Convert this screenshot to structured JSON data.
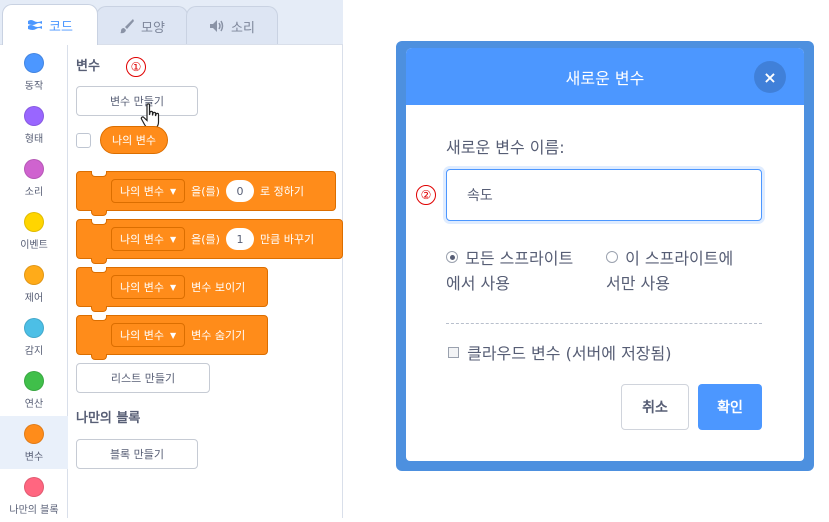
{
  "tabs": [
    {
      "label": "코드",
      "icon": "code-icon"
    },
    {
      "label": "모양",
      "icon": "brush-icon"
    },
    {
      "label": "소리",
      "icon": "speaker-icon"
    }
  ],
  "categories": [
    {
      "label": "동작",
      "color": "#4c97ff"
    },
    {
      "label": "형태",
      "color": "#9966ff"
    },
    {
      "label": "소리",
      "color": "#cf63cf"
    },
    {
      "label": "이벤트",
      "color": "#ffd500"
    },
    {
      "label": "제어",
      "color": "#ffab19"
    },
    {
      "label": "감지",
      "color": "#4cbfe6"
    },
    {
      "label": "연산",
      "color": "#40bf4a"
    },
    {
      "label": "변수",
      "color": "#ff8c1a"
    },
    {
      "label": "나만의 블록",
      "color": "#ff6680"
    }
  ],
  "palette": {
    "variables_heading": "변수",
    "annotation_1": "①",
    "make_variable_button": "변수 만들기",
    "my_variable_reporter": "나의 변수",
    "blocks": {
      "set": {
        "var": "나의 변수",
        "mid": "을(를)",
        "value": "0",
        "end": "로 정하기"
      },
      "change": {
        "var": "나의 변수",
        "mid": "을(를)",
        "value": "1",
        "end": "만큼 바꾸기"
      },
      "show": {
        "var": "나의 변수",
        "end": "변수 보이기"
      },
      "hide": {
        "var": "나의 변수",
        "end": "변수 숨기기"
      }
    },
    "make_list_button": "리스트 만들기",
    "my_blocks_heading": "나만의 블록",
    "make_block_button": "블록 만들기"
  },
  "dialog": {
    "title": "새로운 변수",
    "close_glyph": "×",
    "name_label": "새로운 변수 이름:",
    "annotation_2": "②",
    "name_input_value": "속도",
    "radio_all_line1": "모든 스프라이트",
    "radio_all_line2": "에서 사용",
    "radio_this_line1": "이 스프라이트에",
    "radio_this_line2": "서만 사용",
    "selected_scope": "all",
    "cloud_label": "클라우드 변수 (서버에 저장됨)",
    "cancel_label": "취소",
    "ok_label": "확인"
  },
  "colors": {
    "accent": "#4c97ff",
    "variables": "#ff8c1a",
    "text": "#575e75"
  }
}
